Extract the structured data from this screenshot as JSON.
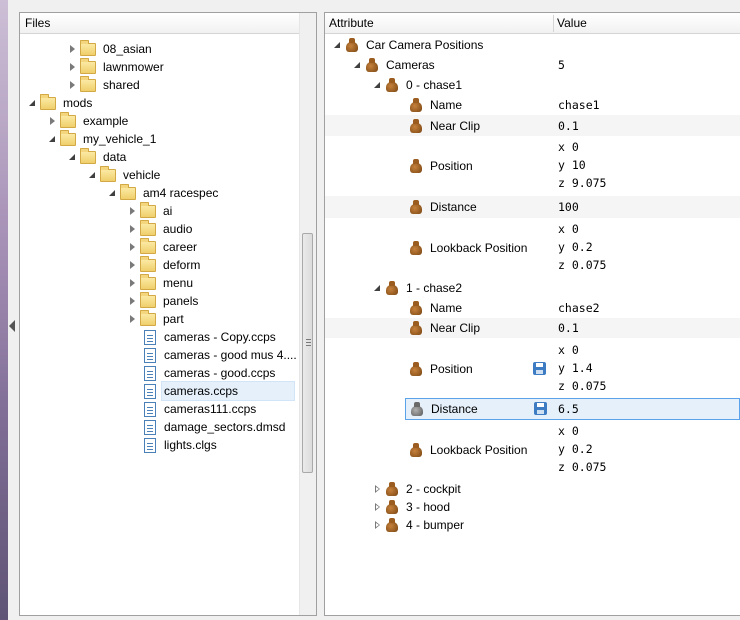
{
  "files_panel": {
    "header": "Files",
    "items": [
      {
        "label": "08_asian",
        "kind": "folder",
        "expander": "closed"
      },
      {
        "label": "lawnmower",
        "kind": "folder",
        "expander": "closed"
      },
      {
        "label": "shared",
        "kind": "folder",
        "expander": "closed"
      },
      {
        "label": "mods",
        "kind": "folder",
        "expander": "open"
      },
      {
        "label": "example",
        "kind": "folder",
        "expander": "closed"
      },
      {
        "label": "my_vehicle_1",
        "kind": "folder",
        "expander": "open"
      },
      {
        "label": "data",
        "kind": "folder",
        "expander": "open"
      },
      {
        "label": "vehicle",
        "kind": "folder",
        "expander": "open"
      },
      {
        "label": "am4 racespec",
        "kind": "folder",
        "expander": "open"
      },
      {
        "label": "ai",
        "kind": "folder",
        "expander": "closed"
      },
      {
        "label": "audio",
        "kind": "folder",
        "expander": "closed"
      },
      {
        "label": "career",
        "kind": "folder",
        "expander": "closed"
      },
      {
        "label": "deform",
        "kind": "folder",
        "expander": "closed"
      },
      {
        "label": "menu",
        "kind": "folder",
        "expander": "closed"
      },
      {
        "label": "panels",
        "kind": "folder",
        "expander": "closed"
      },
      {
        "label": "part",
        "kind": "folder",
        "expander": "closed"
      },
      {
        "label": "cameras - Copy.ccps",
        "kind": "file"
      },
      {
        "label": "cameras - good mus 4....",
        "kind": "file"
      },
      {
        "label": "cameras - good.ccps",
        "kind": "file"
      },
      {
        "label": "cameras.ccps",
        "kind": "file",
        "selected": true
      },
      {
        "label": "cameras111.ccps",
        "kind": "file"
      },
      {
        "label": "damage_sectors.dmsd",
        "kind": "file"
      },
      {
        "label": "lights.clgs",
        "kind": "file"
      }
    ]
  },
  "attr_panel": {
    "col_attribute": "Attribute",
    "col_value": "Value",
    "rows": {
      "root": {
        "name": "Car Camera Positions",
        "value": ""
      },
      "cameras": {
        "name": "Cameras",
        "value": "5"
      },
      "chase1": {
        "name": "0 - chase1",
        "value": ""
      },
      "c1_name": {
        "name": "Name",
        "value": "chase1"
      },
      "c1_near": {
        "name": "Near Clip",
        "value": "0.1"
      },
      "c1_pos": {
        "name": "Position",
        "x": "x 0",
        "y": "y 10",
        "z": "z 9.075"
      },
      "c1_dist": {
        "name": "Distance",
        "value": "100"
      },
      "c1_look": {
        "name": "Lookback Position",
        "x": "x 0",
        "y": "y 0.2",
        "z": "z 0.075"
      },
      "chase2": {
        "name": "1 - chase2",
        "value": ""
      },
      "c2_name": {
        "name": "Name",
        "value": "chase2"
      },
      "c2_near": {
        "name": "Near Clip",
        "value": "0.1"
      },
      "c2_pos": {
        "name": "Position",
        "x": "x 0",
        "y": "y 1.4",
        "z": "z 0.075"
      },
      "c2_dist": {
        "name": "Distance",
        "value": "6.5"
      },
      "c2_look": {
        "name": "Lookback Position",
        "x": "x 0",
        "y": "y 0.2",
        "z": "z 0.075"
      },
      "cockpit": {
        "name": "2 - cockpit"
      },
      "hood": {
        "name": "3 - hood"
      },
      "bumper": {
        "name": "4 - bumper"
      }
    }
  }
}
